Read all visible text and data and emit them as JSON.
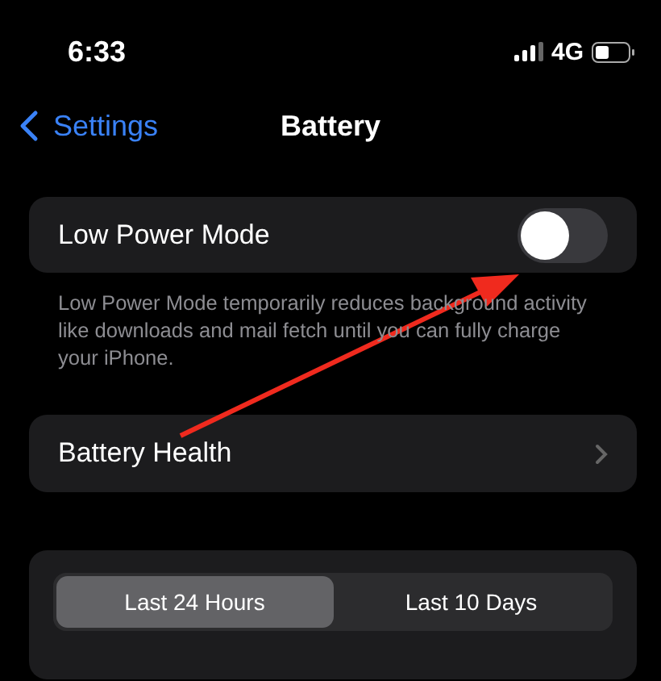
{
  "status_bar": {
    "time": "6:33",
    "network": "4G"
  },
  "nav": {
    "back": "Settings",
    "title": "Battery"
  },
  "low_power": {
    "label": "Low Power Mode",
    "on": false,
    "footer": "Low Power Mode temporarily reduces background activity like downloads and mail fetch until you can fully charge your iPhone."
  },
  "rows": [
    {
      "label": "Battery Health"
    }
  ],
  "segments": [
    {
      "label": "Last 24 Hours",
      "selected": true
    },
    {
      "label": "Last 10 Days",
      "selected": false
    }
  ]
}
